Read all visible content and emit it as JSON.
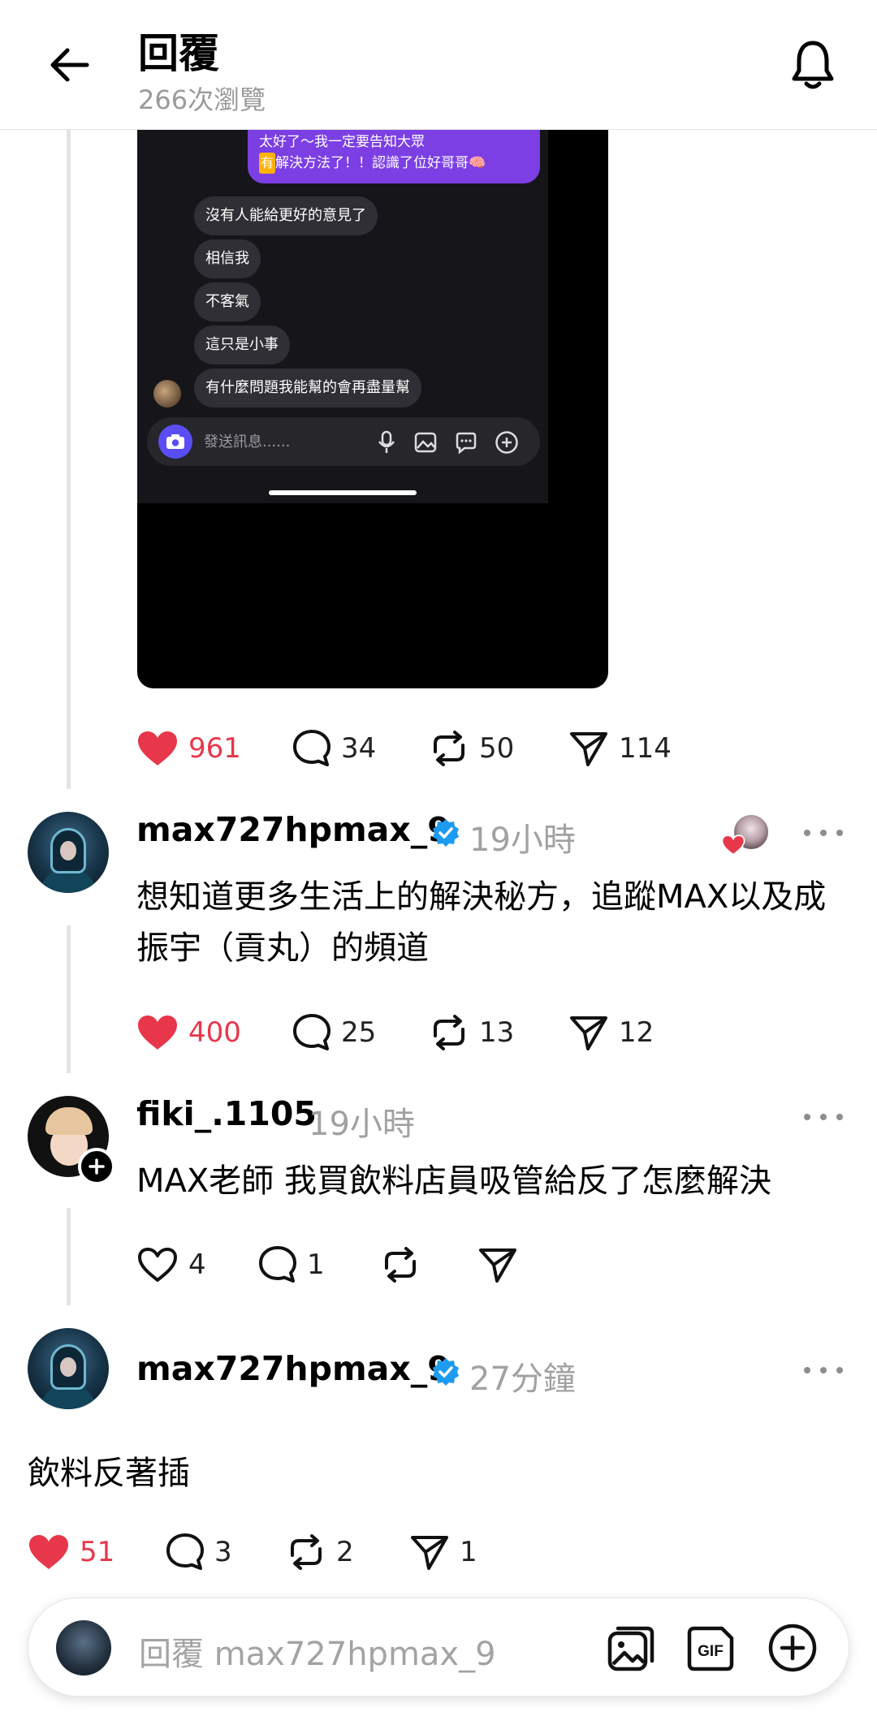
{
  "header": {
    "title": "回覆",
    "view_count": "266次瀏覽"
  },
  "screenshot": {
    "purple_line1": "太好了～我一定要告知大眾",
    "purple_badge": "有",
    "purple_line2": "解決方法了！！認識了位好哥哥🧠",
    "messages": [
      "沒有人能給更好的意見了",
      "相信我",
      "不客氣",
      "這只是小事",
      "有什麼問題我能幫的會再盡量幫"
    ],
    "input_placeholder": "發送訊息......"
  },
  "post_actions": {
    "likes": "961",
    "comments": "34",
    "reposts": "50",
    "shares": "114"
  },
  "replies": [
    {
      "username": "max727hpmax_9",
      "verified": true,
      "time": "19小時",
      "text": "想知道更多生活上的解決秘方，追蹤MAX以及成振宇（貢丸）的頻道",
      "likes": "400",
      "comments": "25",
      "reposts": "13",
      "shares": "12",
      "liked": true
    },
    {
      "username": "fiki_.1105",
      "verified": false,
      "time": "19小時",
      "text": "MAX老師 我買飲料店員吸管給反了怎麼解決",
      "likes": "4",
      "comments": "1",
      "reposts": "",
      "shares": "",
      "liked": false
    },
    {
      "username": "max727hpmax_9",
      "verified": true,
      "time": "27分鐘",
      "text": "飲料反著插",
      "likes": "51",
      "comments": "3",
      "reposts": "2",
      "shares": "1",
      "liked": true
    }
  ],
  "composer": {
    "placeholder": "回覆 max727hpmax_9",
    "gif_label": "GIF"
  },
  "colors": {
    "like_red": "#e8364a",
    "verified_blue": "#1d9bf0",
    "dm_purple": "#7b3fe4"
  }
}
